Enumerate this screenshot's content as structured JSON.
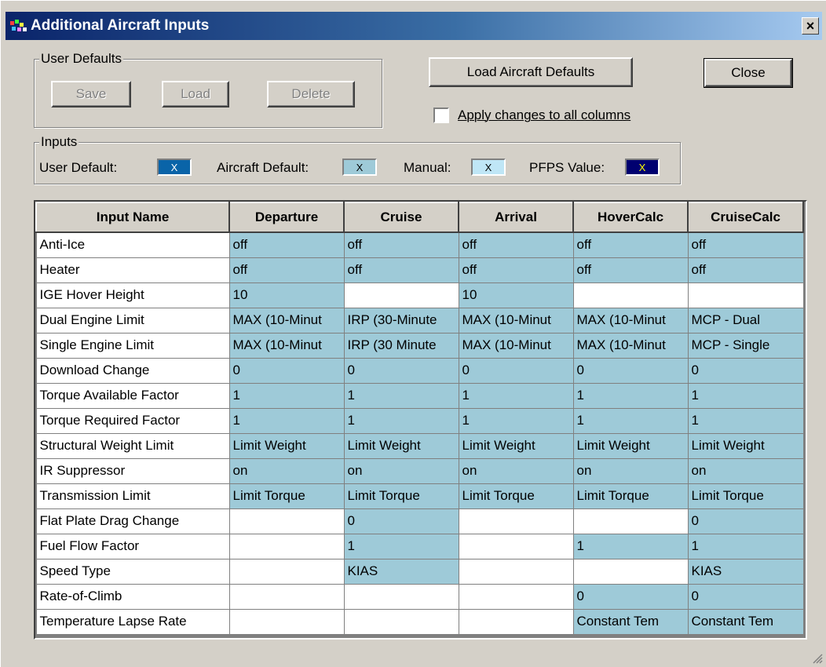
{
  "window": {
    "title": "Additional Aircraft Inputs",
    "close_glyph": "×"
  },
  "user_defaults": {
    "legend": "User Defaults",
    "save_label": "Save",
    "load_label": "Load",
    "delete_label": "Delete"
  },
  "load_aircraft_defaults_label": "Load Aircraft Defaults",
  "close_label": "Close",
  "apply_all": {
    "label": "Apply changes to all columns",
    "checked": false
  },
  "inputs_legend": {
    "legend": "Inputs",
    "user_default_label": "User Default:",
    "aircraft_default_label": "Aircraft Default:",
    "manual_label": "Manual:",
    "pfps_label": "PFPS Value:",
    "swatch_text": "X",
    "colors": {
      "user_default": "#0a64a8",
      "aircraft_default": "#9ecad8",
      "manual": "#bfe6f6",
      "pfps": "#000070",
      "pfps_text": "#ffff00"
    }
  },
  "grid": {
    "headers": [
      "Input Name",
      "Departure",
      "Cruise",
      "Arrival",
      "HoverCalc",
      "CruiseCalc"
    ],
    "rows": [
      {
        "name": "Anti-Ice",
        "cells": [
          "off",
          "off",
          "off",
          "off",
          "off"
        ]
      },
      {
        "name": "Heater",
        "cells": [
          "off",
          "off",
          "off",
          "off",
          "off"
        ]
      },
      {
        "name": "IGE Hover Height",
        "cells": [
          "10",
          "",
          "10",
          "",
          ""
        ]
      },
      {
        "name": "Dual Engine Limit",
        "cells": [
          "MAX (10-Minut",
          "IRP (30-Minute",
          "MAX (10-Minut",
          "MAX (10-Minut",
          "MCP - Dual"
        ]
      },
      {
        "name": "Single Engine Limit",
        "cells": [
          "MAX (10-Minut",
          "IRP (30 Minute",
          "MAX (10-Minut",
          "MAX (10-Minut",
          "MCP - Single"
        ]
      },
      {
        "name": "Download Change",
        "cells": [
          "0",
          "0",
          "0",
          "0",
          "0"
        ]
      },
      {
        "name": "Torque Available Factor",
        "cells": [
          "1",
          "1",
          "1",
          "1",
          "1"
        ]
      },
      {
        "name": "Torque Required Factor",
        "cells": [
          "1",
          "1",
          "1",
          "1",
          "1"
        ]
      },
      {
        "name": "Structural Weight Limit",
        "cells": [
          "Limit Weight",
          "Limit Weight",
          "Limit Weight",
          "Limit Weight",
          "Limit Weight"
        ]
      },
      {
        "name": "IR Suppressor",
        "cells": [
          "on",
          "on",
          "on",
          "on",
          "on"
        ]
      },
      {
        "name": "Transmission Limit",
        "cells": [
          "Limit Torque",
          "Limit Torque",
          "Limit Torque",
          "Limit Torque",
          "Limit Torque"
        ]
      },
      {
        "name": "Flat Plate Drag Change",
        "cells": [
          "",
          "0",
          "",
          "",
          "0"
        ]
      },
      {
        "name": "Fuel Flow Factor",
        "cells": [
          "",
          "1",
          "",
          "1",
          "1"
        ]
      },
      {
        "name": "Speed Type",
        "cells": [
          "",
          "KIAS",
          "",
          "",
          "KIAS"
        ]
      },
      {
        "name": "Rate-of-Climb",
        "cells": [
          "",
          "",
          "",
          "0",
          "0"
        ]
      },
      {
        "name": "Temperature Lapse Rate",
        "cells": [
          "",
          "",
          "",
          "Constant Tem",
          "Constant Tem"
        ]
      }
    ]
  }
}
